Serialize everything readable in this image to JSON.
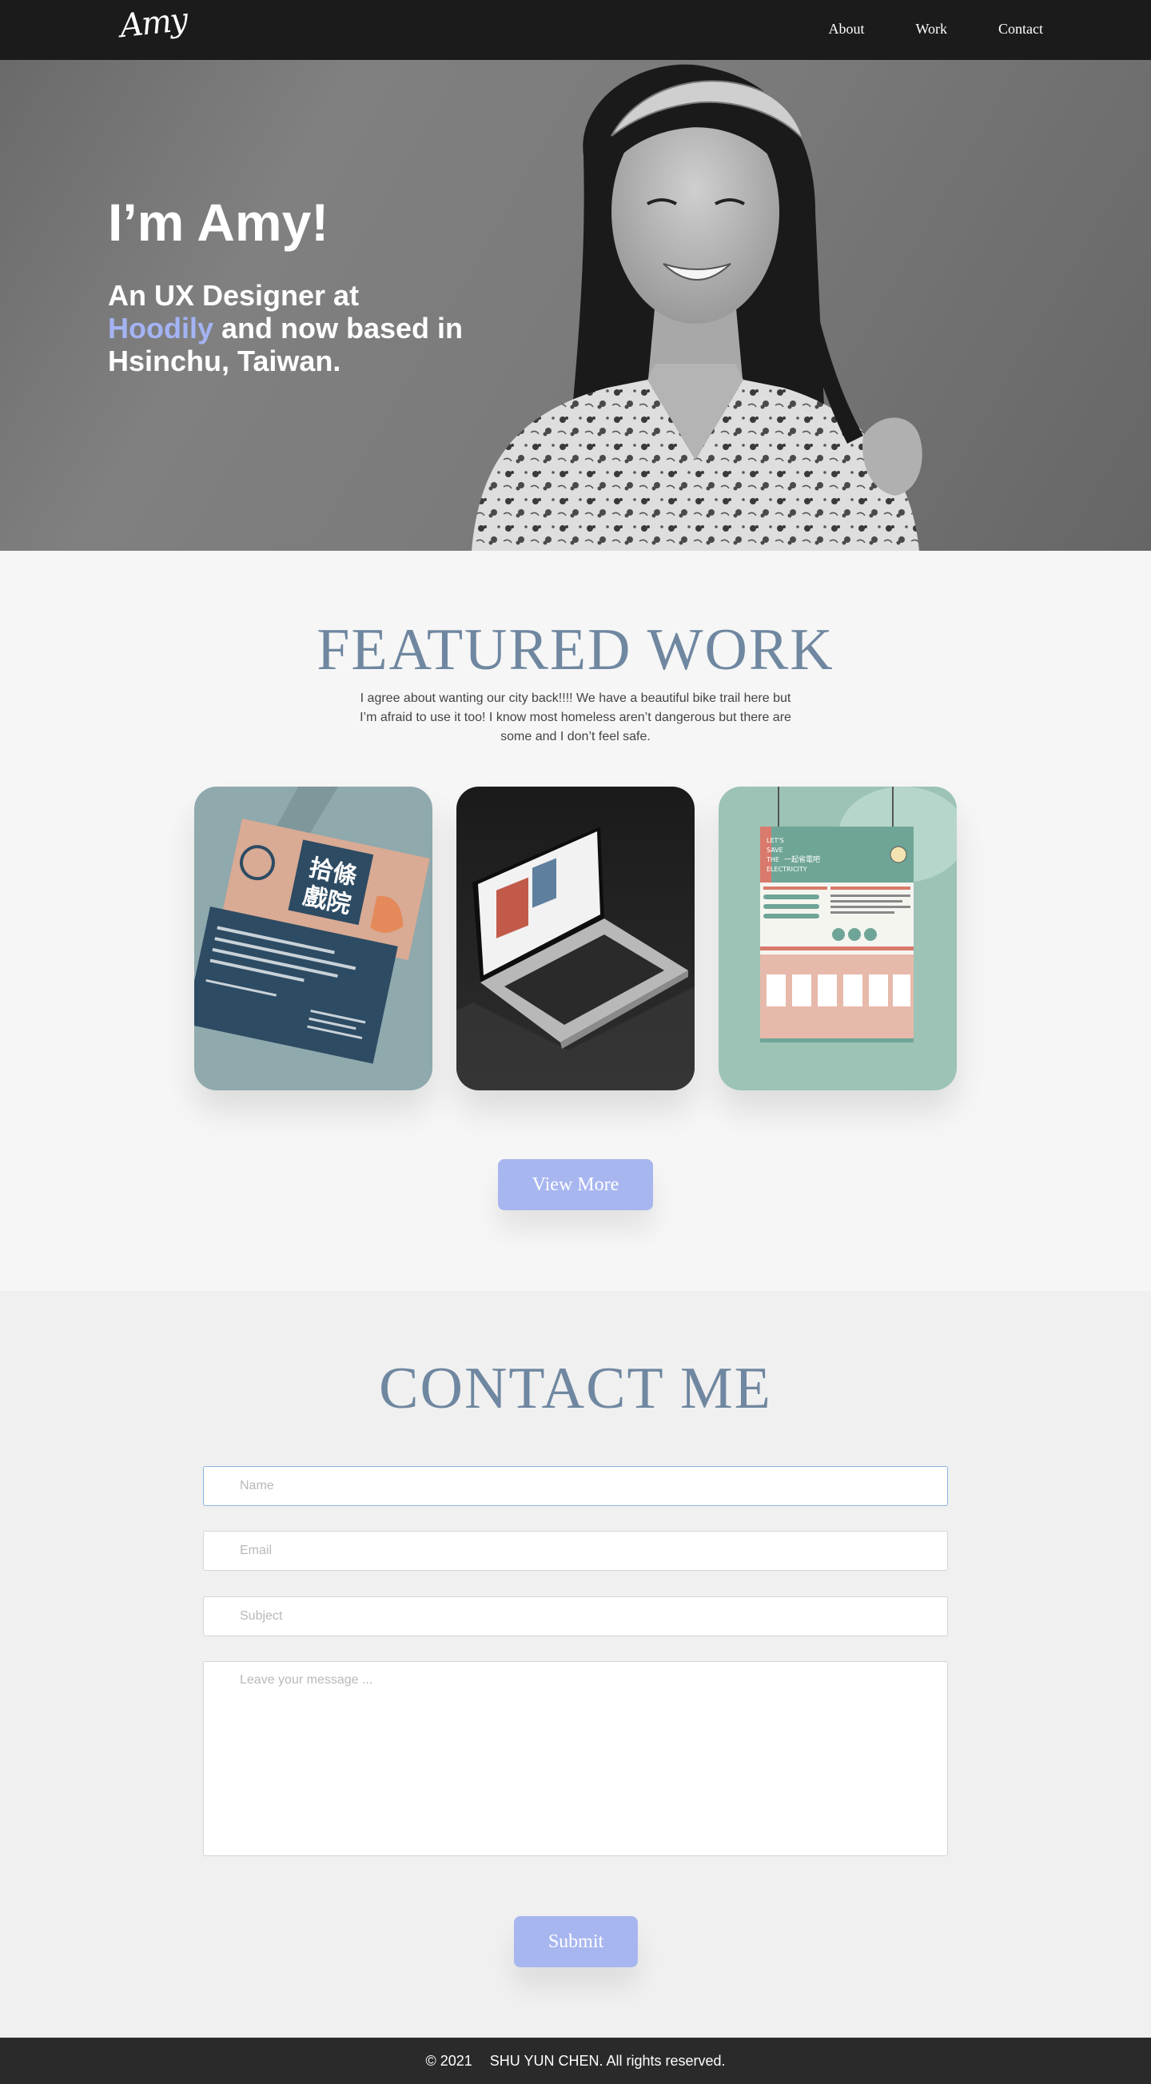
{
  "nav": {
    "logo": "Amy",
    "links": [
      "About",
      "Work",
      "Contact"
    ]
  },
  "hero": {
    "title": "I’m Amy!",
    "subtitle_prefix": "An UX Designer at ",
    "subtitle_accent": "Hoodily",
    "subtitle_suffix": " and now based in Hsinchu, Taiwan."
  },
  "featured": {
    "title": "FEATURED WORK",
    "description": "I agree about wanting our city back!!!! We have a beautiful bike trail here but I’m afraid to use it too! I know most homeless aren’t dangerous but there are some and I don’t feel safe.",
    "cards": [
      {
        "name": "business-cards-project",
        "card_text": [
          "拾條",
          "戲院"
        ]
      },
      {
        "name": "laptop-website-project"
      },
      {
        "name": "poster-project",
        "poster_text": [
          "LET'S",
          "SAVE",
          "THE",
          "ELECTRICITY",
          "一起省電吧"
        ]
      }
    ],
    "view_more": "View More"
  },
  "contact": {
    "title": "CONTACT ME",
    "name_placeholder": "Name",
    "email_placeholder": "Email",
    "subject_placeholder": "Subject",
    "message_placeholder": "Leave your message ...",
    "submit": "Submit"
  },
  "footer": {
    "year": "© 2021",
    "owner": "SHU YUN CHEN. All rights reserved."
  },
  "colors": {
    "accent": "#a4b3f4",
    "button": "#a8b6f0",
    "heading": "#6f87a0",
    "nav_bg": "#1b1b1b",
    "footer_bg": "#2a2a2a"
  }
}
